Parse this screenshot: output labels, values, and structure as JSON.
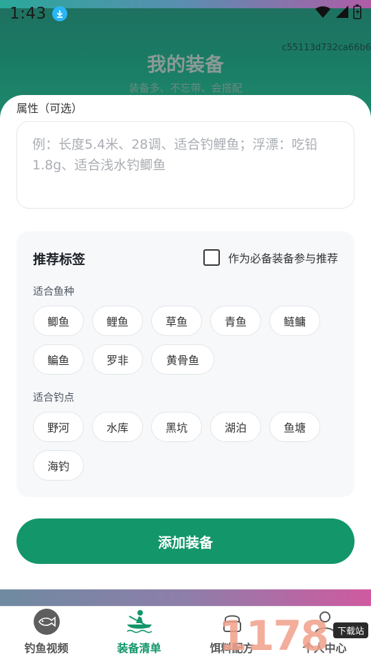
{
  "status": {
    "time": "1:43"
  },
  "header": {
    "hash": "c55113d732ca66b6",
    "title": "我的装备",
    "subtitle": "装备多、不忘带、会搭配"
  },
  "form": {
    "attr_label": "属性（可选）",
    "attr_placeholder": "例：长度5.4米、28调、适合钓鲤鱼；浮漂：吃铅1.8g、适合浅水钓鲫鱼"
  },
  "tags": {
    "title": "推荐标签",
    "must_label": "作为必备装备参与推荐",
    "must_checked": false,
    "fish_label": "适合鱼种",
    "fish": [
      "鲫鱼",
      "鲤鱼",
      "草鱼",
      "青鱼",
      "鲢鳙",
      "鳊鱼",
      "罗非",
      "黄骨鱼"
    ],
    "spot_label": "适合钓点",
    "spots": [
      "野河",
      "水库",
      "黑坑",
      "湖泊",
      "鱼塘",
      "海钓"
    ]
  },
  "add_button": "添加装备",
  "tabbar": {
    "items": [
      {
        "label": "钓鱼视频",
        "icon": "fish-icon",
        "active": false
      },
      {
        "label": "装备清单",
        "icon": "kayak-icon",
        "active": true
      },
      {
        "label": "饵料配方",
        "icon": "bait-icon",
        "active": false
      },
      {
        "label": "个人中心",
        "icon": "person-icon",
        "active": false
      }
    ]
  },
  "watermark": {
    "text": "1178",
    "badge": "下载站"
  },
  "colors": {
    "accent": "#12966a",
    "header_bg": "#1a7a64"
  }
}
